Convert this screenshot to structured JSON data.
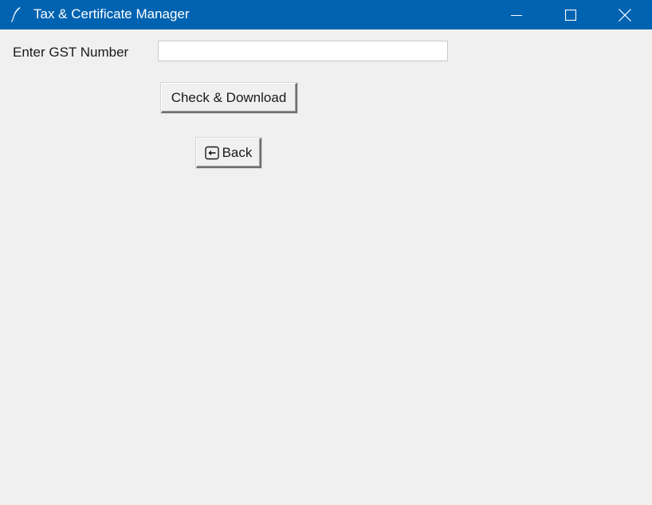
{
  "window": {
    "title": "Tax & Certificate Manager",
    "titlebar_color": "#0063b1",
    "icons": {
      "app": "feather-icon",
      "minimize": "minimize-icon",
      "maximize": "maximize-icon",
      "close": "close-icon"
    }
  },
  "form": {
    "gst_label": "Enter GST Number",
    "gst_value": "",
    "gst_placeholder": "",
    "check_button_label": "Check & Download",
    "back_button_label": "Back",
    "back_icon": "back-arrow-icon"
  }
}
